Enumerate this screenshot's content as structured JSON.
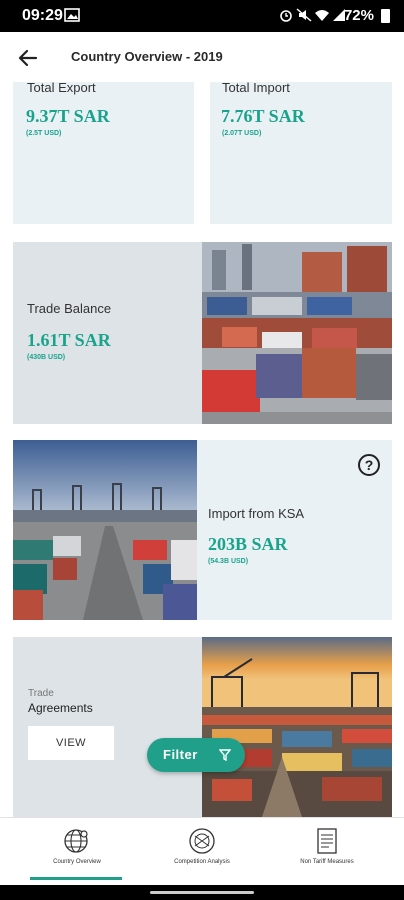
{
  "status_bar": {
    "time": "09:29",
    "battery": "72%"
  },
  "header": {
    "title": "Country Overview - 2019"
  },
  "cards": {
    "total_export": {
      "label": "Total Export",
      "value": "9.37T SAR",
      "sub": "(2.5T USD)"
    },
    "total_import": {
      "label": "Total Import",
      "value": "7.76T SAR",
      "sub": "(2.07T USD)"
    },
    "trade_balance": {
      "label": "Trade Balance",
      "value": "1.61T SAR",
      "sub": "(430B USD)"
    },
    "import_from_ksa": {
      "label": "Import from KSA",
      "value": "203B SAR",
      "sub": "(54.3B USD)"
    },
    "trade_agreements": {
      "label_small": "Trade",
      "label": "Agreements",
      "button": "VIEW"
    }
  },
  "filter": {
    "label": "Filter"
  },
  "bottom_nav": {
    "items": [
      {
        "label": "Country Overview",
        "icon": "globe-icon"
      },
      {
        "label": "Competition Analysis",
        "icon": "competition-icon"
      },
      {
        "label": "Non Tariff Measures",
        "icon": "document-icon"
      }
    ]
  },
  "colors": {
    "accent": "#20a08a",
    "card_light": "#eaf1f5",
    "card_grey": "#dde3e7"
  }
}
